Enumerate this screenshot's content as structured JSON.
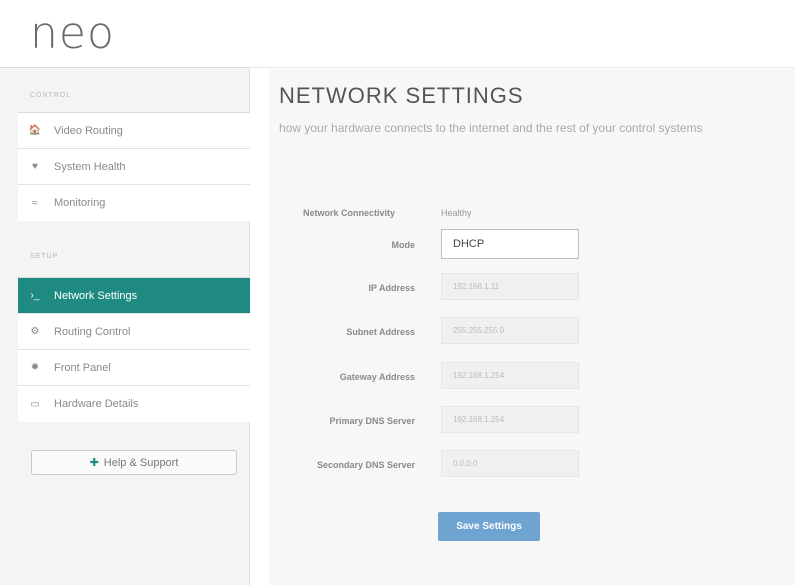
{
  "logo": "neo",
  "sidebar": {
    "sections": [
      {
        "label": "CONTROL"
      },
      {
        "label": "SETUP"
      }
    ],
    "control_items": [
      {
        "label": "Video Routing",
        "icon": "home-icon",
        "glyph": "🏠"
      },
      {
        "label": "System Health",
        "icon": "heart-icon",
        "glyph": "♥"
      },
      {
        "label": "Monitoring",
        "icon": "rss-icon",
        "glyph": "≈"
      }
    ],
    "setup_items": [
      {
        "label": "Network Settings",
        "icon": "terminal-icon",
        "glyph": "›_",
        "active": true
      },
      {
        "label": "Routing Control",
        "icon": "cogs-icon",
        "glyph": "⚙"
      },
      {
        "label": "Front Panel",
        "icon": "dial-icon",
        "glyph": "✹"
      },
      {
        "label": "Hardware Details",
        "icon": "hdd-icon",
        "glyph": "▭"
      }
    ],
    "help_label": "Help & Support",
    "help_glyph": "✚"
  },
  "page": {
    "title": "NETWORK SETTINGS",
    "description": "how your hardware connects to the internet and the rest of your control systems"
  },
  "form": {
    "connectivity_label": "Network Connectivity",
    "connectivity_value": "Healthy",
    "mode_label": "Mode",
    "mode_value": "DHCP",
    "ip_label": "IP Address",
    "ip_value": "192.168.1.11",
    "subnet_label": "Subnet Address",
    "subnet_value": "255.255.255.0",
    "gateway_label": "Gateway Address",
    "gateway_value": "192.168.1.254",
    "primary_dns_label": "Primary DNS Server",
    "primary_dns_value": "192.168.1.254",
    "secondary_dns_label": "Secondary DNS Server",
    "secondary_dns_value": "0.0.0.0",
    "save_label": "Save Settings"
  },
  "colors": {
    "accent": "#1e8a82",
    "button": "#6fa3d2"
  }
}
